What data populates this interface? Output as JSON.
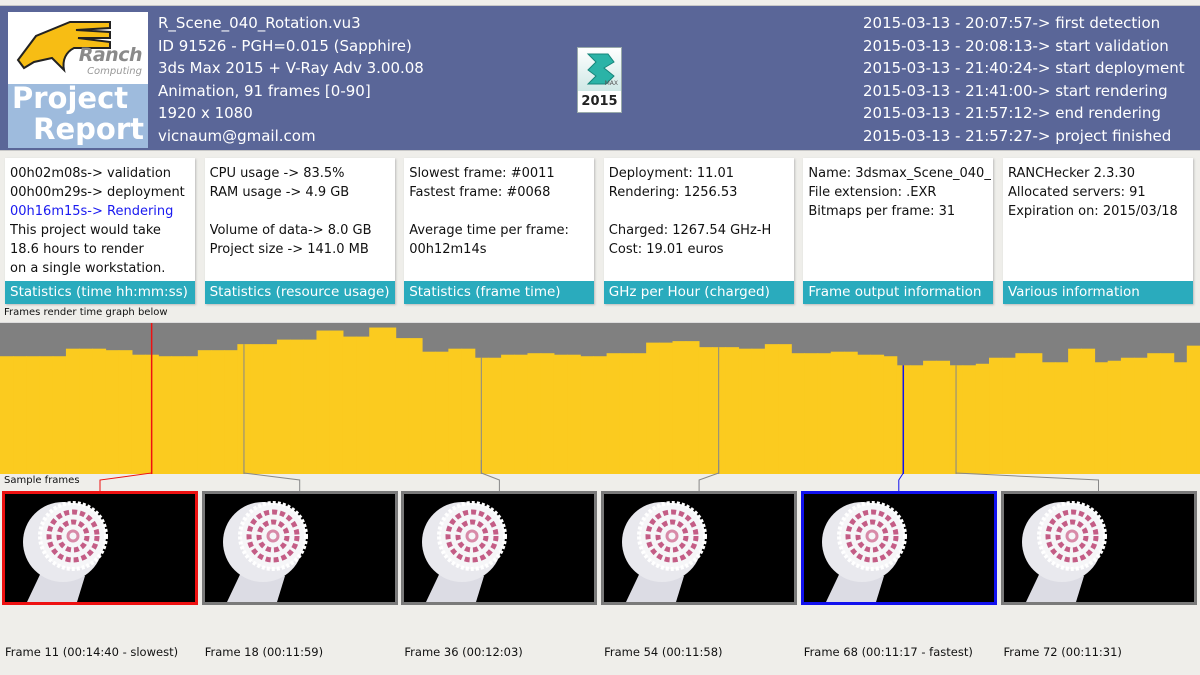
{
  "header": {
    "logo": {
      "brand": "Ranch",
      "brand_sub": "Computing",
      "line1": "Project",
      "line2": "Report"
    },
    "info": [
      "R_Scene_040_Rotation.vu3",
      "ID 91526 - PGH=0.015 (Sapphire)",
      "3ds Max 2015 + V-Ray Adv 3.00.08",
      "Animation, 91 frames [0-90]",
      "1920 x 1080",
      "vicnaum@gmail.com"
    ],
    "app_icon": {
      "name": "3ds-max-icon",
      "tag": "MAX",
      "year": "2015"
    },
    "timeline": [
      "2015-03-13 - 20:07:57-> first detection",
      "2015-03-13 - 20:08:13-> start validation",
      "2015-03-13 - 21:40:24-> start deployment",
      "2015-03-13 - 21:41:00-> start rendering",
      "2015-03-13 - 21:57:12-> end rendering",
      "2015-03-13 - 21:57:27-> project finished"
    ]
  },
  "cards": [
    {
      "id": "time",
      "lines": [
        "00h02m08s-> validation",
        "00h00m29s-> deployment",
        "00h16m15s-> Rendering",
        "This project would take",
        "18.6 hours to render",
        "on a single workstation."
      ],
      "highlight_line": 2,
      "footer": "Statistics (time hh:mm:ss)"
    },
    {
      "id": "resource",
      "lines": [
        "CPU usage -> 83.5%",
        "RAM usage -> 4.9 GB",
        "",
        "Volume of data-> 8.0 GB",
        "Project size -> 141.0 MB"
      ],
      "footer": "Statistics (resource usage)"
    },
    {
      "id": "frametime",
      "lines": [
        "Slowest frame: #0011",
        "Fastest frame: #0068",
        "",
        "Average time per frame:",
        "00h12m14s"
      ],
      "footer": "Statistics (frame time)"
    },
    {
      "id": "ghz",
      "lines": [
        "Deployment:    11.01",
        "Rendering:  1256.53",
        "",
        "Charged:  1267.54 GHz-H",
        "Cost: 19.01 euros"
      ],
      "footer": "GHz per Hour (charged)"
    },
    {
      "id": "output",
      "lines": [
        "Name: 3dsmax_Scene_040_",
        "File extension: .EXR",
        "Bitmaps per frame: 31"
      ],
      "footer": "Frame output information"
    },
    {
      "id": "various",
      "lines": [
        "RANCHecker 2.3.30",
        "Allocated servers: 91",
        "Expiration on: 2015/03/18"
      ],
      "footer": "Various information"
    }
  ],
  "graph": {
    "caption": "Frames render time graph below",
    "colors": {
      "bar": "#fbcb1f",
      "background": "#808080",
      "slowest": "#ee1111",
      "fastest": "#1111ee",
      "marker": "#888888"
    },
    "frame_count": 91,
    "relative_heights": [
      0.78,
      0.78,
      0.78,
      0.78,
      0.78,
      0.83,
      0.83,
      0.83,
      0.82,
      0.82,
      0.79,
      0.79,
      0.78,
      0.78,
      0.78,
      0.82,
      0.82,
      0.82,
      0.86,
      0.86,
      0.86,
      0.89,
      0.89,
      0.89,
      0.95,
      0.95,
      0.91,
      0.91,
      0.97,
      0.97,
      0.9,
      0.9,
      0.81,
      0.81,
      0.83,
      0.83,
      0.77,
      0.77,
      0.79,
      0.79,
      0.8,
      0.8,
      0.79,
      0.79,
      0.78,
      0.78,
      0.8,
      0.8,
      0.8,
      0.87,
      0.87,
      0.88,
      0.88,
      0.84,
      0.84,
      0.84,
      0.83,
      0.83,
      0.86,
      0.86,
      0.8,
      0.8,
      0.8,
      0.81,
      0.81,
      0.79,
      0.79,
      0.78,
      0.72,
      0.72,
      0.75,
      0.75,
      0.72,
      0.72,
      0.73,
      0.77,
      0.77,
      0.8,
      0.8,
      0.74,
      0.74,
      0.83,
      0.83,
      0.74,
      0.75,
      0.77,
      0.77,
      0.8,
      0.8,
      0.74,
      0.85
    ],
    "markers": [
      {
        "frame": 11,
        "type": "slowest"
      },
      {
        "frame": 18,
        "type": "normal"
      },
      {
        "frame": 36,
        "type": "normal"
      },
      {
        "frame": 54,
        "type": "normal"
      },
      {
        "frame": 68,
        "type": "fastest"
      },
      {
        "frame": 72,
        "type": "normal"
      }
    ]
  },
  "samples": {
    "caption": "Sample frames",
    "frames": [
      {
        "frame": 11,
        "label": "Frame 11 (00:14:40 - slowest)",
        "type": "slowest"
      },
      {
        "frame": 18,
        "label": "Frame 18 (00:11:59)",
        "type": "normal"
      },
      {
        "frame": 36,
        "label": "Frame 36 (00:12:03)",
        "type": "normal"
      },
      {
        "frame": 54,
        "label": "Frame 54 (00:11:58)",
        "type": "normal"
      },
      {
        "frame": 68,
        "label": "Frame 68 (00:11:17 - fastest)",
        "type": "fastest"
      },
      {
        "frame": 72,
        "label": "Frame 72 (00:11:31)",
        "type": "normal"
      }
    ]
  }
}
